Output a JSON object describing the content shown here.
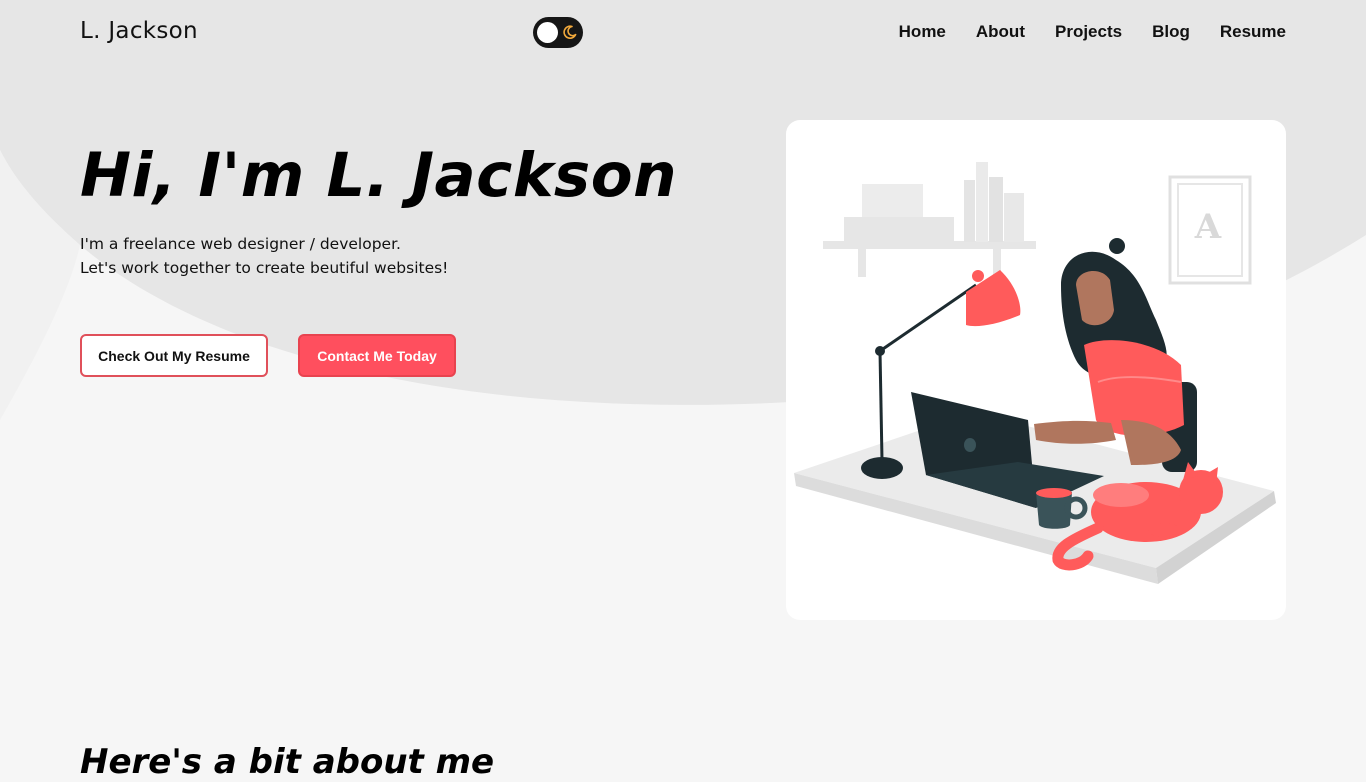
{
  "nav": {
    "logo": "L. Jackson",
    "theme_toggle_icon": "moon-icon",
    "links": [
      "Home",
      "About",
      "Projects",
      "Blog",
      "Resume"
    ]
  },
  "hero": {
    "title": "Hi, I'm L. Jackson",
    "subtitle_line1": "I'm a freelance web designer / developer.",
    "subtitle_line2": "Let's work together to create beutiful websites!",
    "resume_button": "Check Out My Resume",
    "contact_button": "Contact Me Today",
    "illustration_letter": "A"
  },
  "about": {
    "title": "Here's a bit about me"
  },
  "colors": {
    "accent": "#ff4f5e",
    "dark": "#161616",
    "moon": "#f2a93b",
    "wave": "#e6e6e6"
  }
}
